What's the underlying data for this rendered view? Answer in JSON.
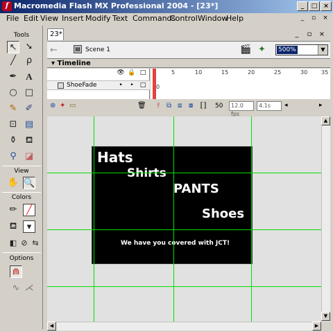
{
  "window": {
    "title": "Macromedia Flash MX Professional 2004 - [23*]",
    "app_icon": "flash-icon",
    "minimize": "_",
    "maximize": "□",
    "close": "×"
  },
  "menu": {
    "items": [
      "File",
      "Edit",
      "View",
      "Insert",
      "Modify",
      "Text",
      "Commands",
      "Control",
      "Window",
      "Help"
    ],
    "doc_minimize": "_",
    "doc_restore": "▫",
    "doc_close": "×"
  },
  "tools": {
    "header": "Tools",
    "view_header": "View",
    "colors_header": "Colors",
    "options_header": "Options",
    "icons": [
      "arrow-icon",
      "subselect-icon",
      "line-icon",
      "lasso-icon",
      "pen-icon",
      "text-icon",
      "oval-icon",
      "rectangle-icon",
      "pencil-icon",
      "brush-icon",
      "free-transform-icon",
      "fill-transform-icon",
      "ink-bottle-icon",
      "paint-bucket-icon",
      "eyedropper-icon",
      "eraser-icon",
      "hand-icon",
      "zoom-icon"
    ]
  },
  "document": {
    "tab": "23*",
    "scene": "Scene 1",
    "zoom": "500%"
  },
  "timeline": {
    "label": "Timeline",
    "layer_name": "ShoeFade",
    "ruler_numbers": [
      "5",
      "10",
      "15",
      "20",
      "25",
      "30",
      "35"
    ],
    "current_frame_marker": "0",
    "frame_value": "50",
    "fps": "12.0 fps",
    "elapsed": "4.1s"
  },
  "stage": {
    "text_hats": "Hats",
    "text_shirts": "Shirts",
    "text_pants": "PANTS",
    "text_shoes": "Shoes",
    "tagline": "We have you covered with JCT!"
  },
  "colors": {
    "stage_background": "#000000",
    "guide_lines": "#00e000",
    "title_gradient_start": "#0a246a"
  }
}
